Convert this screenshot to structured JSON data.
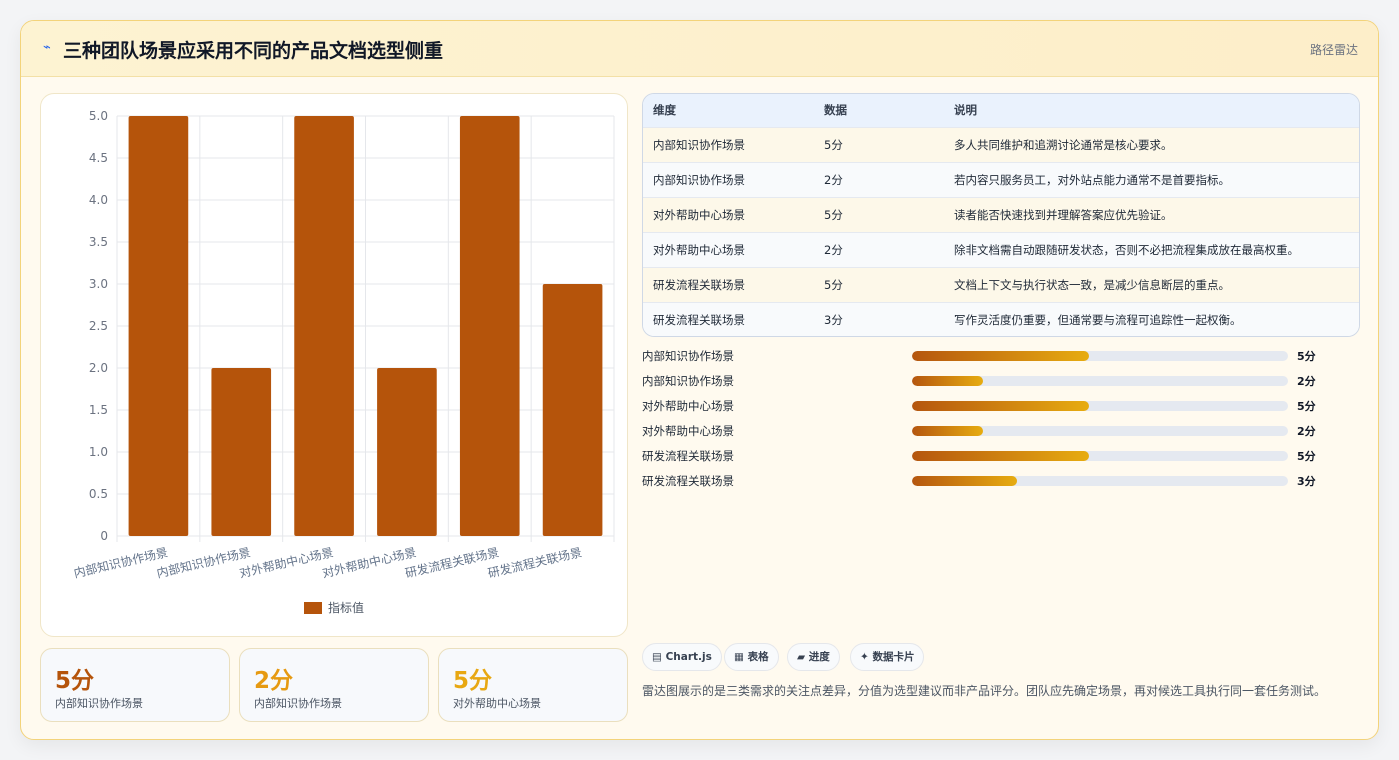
{
  "header": {
    "icon": "lightning-icon",
    "title": "三种团队场景应采用不同的产品文档选型侧重",
    "tag": "路径雷达"
  },
  "chart_data": {
    "type": "bar",
    "categories": [
      "内部知识协作场景",
      "内部知识协作场景",
      "对外帮助中心场景",
      "对外帮助中心场景",
      "研发流程关联场景",
      "研发流程关联场景"
    ],
    "series": [
      {
        "name": "指标值",
        "values": [
          5,
          2,
          5,
          2,
          5,
          3
        ],
        "color": "#b5540b"
      }
    ],
    "ylim": [
      0,
      5
    ],
    "yticks": [
      "0",
      "0.5",
      "1.0",
      "1.5",
      "2.0",
      "2.5",
      "3.0",
      "3.5",
      "4.0",
      "4.5",
      "5.0"
    ],
    "grid": true,
    "legend": "bottom"
  },
  "stats": [
    {
      "value": "5分",
      "label": "内部知识协作场景",
      "color": "#b5540b"
    },
    {
      "value": "2分",
      "label": "内部知识协作场景",
      "color": "#e69a12"
    },
    {
      "value": "5分",
      "label": "对外帮助中心场景",
      "color": "#e8a813"
    }
  ],
  "table": {
    "headers": [
      "维度",
      "数据",
      "说明"
    ],
    "rows": [
      [
        "内部知识协作场景",
        "5分",
        "多人共同维护和追溯讨论通常是核心要求。"
      ],
      [
        "内部知识协作场景",
        "2分",
        "若内容只服务员工，对外站点能力通常不是首要指标。"
      ],
      [
        "对外帮助中心场景",
        "5分",
        "读者能否快速找到并理解答案应优先验证。"
      ],
      [
        "对外帮助中心场景",
        "2分",
        "除非文档需自动跟随研发状态，否则不必把流程集成放在最高权重。"
      ],
      [
        "研发流程关联场景",
        "5分",
        "文档上下文与执行状态一致，是减少信息断层的重点。"
      ],
      [
        "研发流程关联场景",
        "3分",
        "写作灵活度仍重要，但通常要与流程可追踪性一起权衡。"
      ]
    ]
  },
  "progress": [
    {
      "label": "内部知识协作场景",
      "value_text": "5分",
      "fraction": 0.47
    },
    {
      "label": "内部知识协作场景",
      "value_text": "2分",
      "fraction": 0.19
    },
    {
      "label": "对外帮助中心场景",
      "value_text": "5分",
      "fraction": 0.47
    },
    {
      "label": "对外帮助中心场景",
      "value_text": "2分",
      "fraction": 0.19
    },
    {
      "label": "研发流程关联场景",
      "value_text": "5分",
      "fraction": 0.47
    },
    {
      "label": "研发流程关联场景",
      "value_text": "3分",
      "fraction": 0.28
    }
  ],
  "chips": [
    {
      "icon": "chart-icon",
      "glyph": "▤",
      "label": "Chart.js"
    },
    {
      "icon": "table-icon",
      "glyph": "▦",
      "label": "表格"
    },
    {
      "icon": "progress-icon",
      "glyph": "▰",
      "label": "进度"
    },
    {
      "icon": "sparkle-icon",
      "glyph": "✦",
      "label": "数据卡片"
    }
  ],
  "note": "雷达图展示的是三类需求的关注点差异，分值为选型建议而非产品评分。团队应先确定场景，再对候选工具执行同一套任务测试。"
}
